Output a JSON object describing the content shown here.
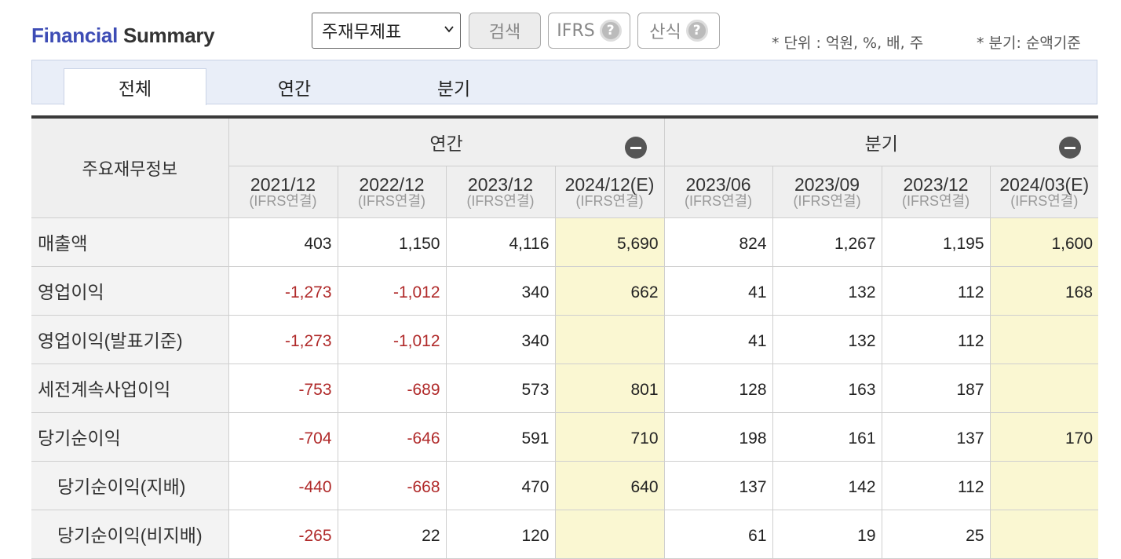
{
  "header": {
    "title_part1": "Financial",
    "title_part2": "Summary",
    "select_value": "주재무제표",
    "search_label": "검색",
    "ifrs_label": "IFRS",
    "formula_label": "산식",
    "help_glyph": "?",
    "unit_note": "* 단위 : 억원, %, 배, 주",
    "quarter_note": "* 분기: 순액기준"
  },
  "tabs": [
    {
      "label": "전체",
      "active": true
    },
    {
      "label": "연간",
      "active": false
    },
    {
      "label": "분기",
      "active": false
    }
  ],
  "table": {
    "corner_label": "주요재무정보",
    "group_annual": "연간",
    "group_quarter": "분기",
    "columns": [
      {
        "period": "2021/12",
        "basis": "(IFRS연결)"
      },
      {
        "period": "2022/12",
        "basis": "(IFRS연결)"
      },
      {
        "period": "2023/12",
        "basis": "(IFRS연결)"
      },
      {
        "period": "2024/12(E)",
        "basis": "(IFRS연결)"
      },
      {
        "period": "2023/06",
        "basis": "(IFRS연결)"
      },
      {
        "period": "2023/09",
        "basis": "(IFRS연결)"
      },
      {
        "period": "2023/12",
        "basis": "(IFRS연결)"
      },
      {
        "period": "2024/03(E)",
        "basis": "(IFRS연결)"
      }
    ],
    "rows": [
      {
        "label": "매출액",
        "values": [
          "403",
          "1,150",
          "4,116",
          "5,690",
          "824",
          "1,267",
          "1,195",
          "1,600"
        ]
      },
      {
        "label": "영업이익",
        "values": [
          "-1,273",
          "-1,012",
          "340",
          "662",
          "41",
          "132",
          "112",
          "168"
        ]
      },
      {
        "label": "영업이익(발표기준)",
        "values": [
          "-1,273",
          "-1,012",
          "340",
          "",
          "41",
          "132",
          "112",
          ""
        ]
      },
      {
        "label": "세전계속사업이익",
        "values": [
          "-753",
          "-689",
          "573",
          "801",
          "128",
          "163",
          "187",
          ""
        ]
      },
      {
        "label": "당기순이익",
        "values": [
          "-704",
          "-646",
          "591",
          "710",
          "198",
          "161",
          "137",
          "170"
        ]
      },
      {
        "label": "당기순이익(지배)",
        "values": [
          "-440",
          "-668",
          "470",
          "640",
          "137",
          "142",
          "112",
          ""
        ]
      },
      {
        "label": "당기순이익(비지배)",
        "values": [
          "-265",
          "22",
          "120",
          "",
          "61",
          "19",
          "25",
          ""
        ]
      }
    ]
  },
  "colors": {
    "title_blue": "#3d4cb5",
    "negative": "#b02a2a",
    "estimate_bg": "#faf7d2",
    "tabbar_bg": "#e9eef8"
  }
}
